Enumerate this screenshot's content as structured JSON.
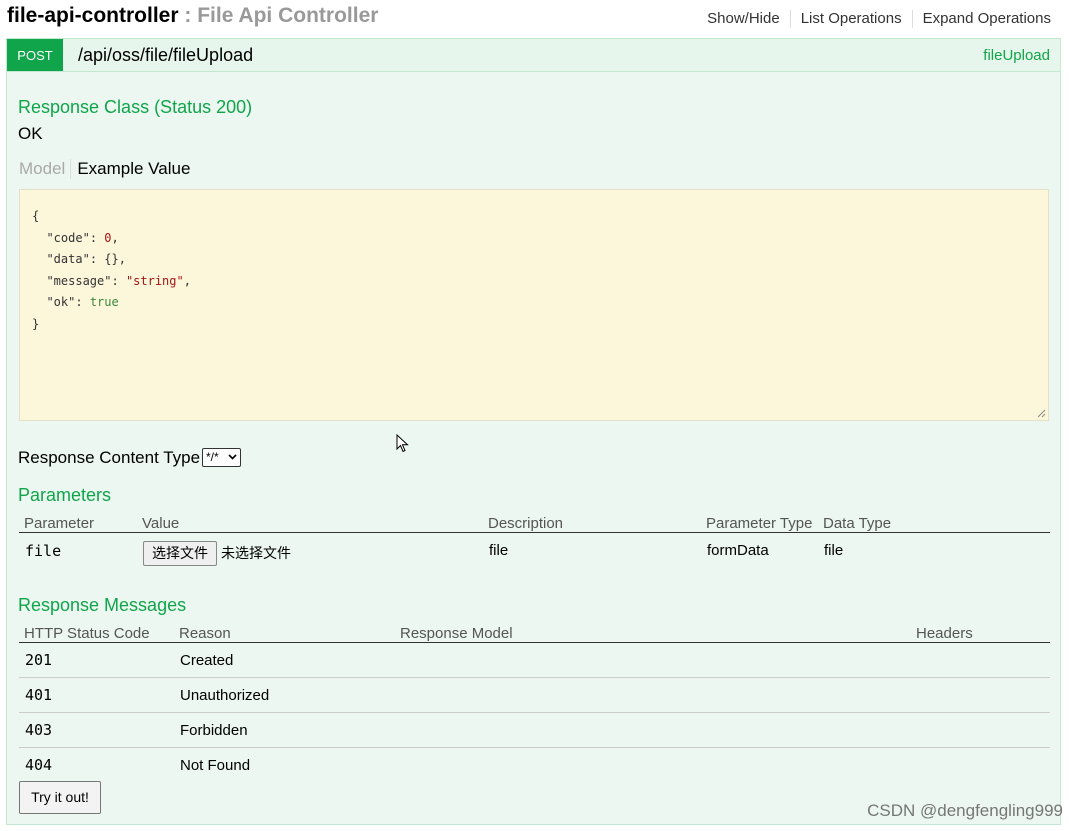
{
  "header": {
    "controller_name": "file-api-controller",
    "separator": " : ",
    "controller_title": "File Api Controller",
    "links": [
      "Show/Hide",
      "List Operations",
      "Expand Operations"
    ]
  },
  "operation": {
    "method": "POST",
    "path": "/api/oss/file/fileUpload",
    "operation_id": "fileUpload"
  },
  "response_class": {
    "title": "Response Class (Status 200)",
    "value": "OK",
    "tab_model": "Model",
    "tab_example": "Example Value"
  },
  "example": {
    "open": "{",
    "fields": [
      {
        "key": "\"code\"",
        "value": "0",
        "type": "num",
        "comma": ","
      },
      {
        "key": "\"data\"",
        "value": "{}",
        "type": "plain",
        "comma": ","
      },
      {
        "key": "\"message\"",
        "value": "\"string\"",
        "type": "str",
        "comma": ","
      },
      {
        "key": "\"ok\"",
        "value": "true",
        "type": "bool",
        "comma": ""
      }
    ],
    "close": "}"
  },
  "content_type": {
    "label": "Response Content Type",
    "selected": "*/*"
  },
  "parameters": {
    "title": "Parameters",
    "columns": [
      "Parameter",
      "Value",
      "Description",
      "Parameter Type",
      "Data Type"
    ],
    "rows": [
      {
        "name": "file",
        "button": "选择文件",
        "status": "未选择文件",
        "description": "file",
        "param_type": "formData",
        "data_type": "file"
      }
    ]
  },
  "response_messages": {
    "title": "Response Messages",
    "columns": [
      "HTTP Status Code",
      "Reason",
      "Response Model",
      "Headers"
    ],
    "rows": [
      {
        "code": "201",
        "reason": "Created"
      },
      {
        "code": "401",
        "reason": "Unauthorized"
      },
      {
        "code": "403",
        "reason": "Forbidden"
      },
      {
        "code": "404",
        "reason": "Not Found"
      }
    ]
  },
  "try_button": "Try it out!",
  "watermark": "CSDN @dengfengling999",
  "colors": {
    "accent_green": "#10a54a",
    "panel_bg": "#ebf7f0",
    "code_bg": "#fcf6db"
  }
}
